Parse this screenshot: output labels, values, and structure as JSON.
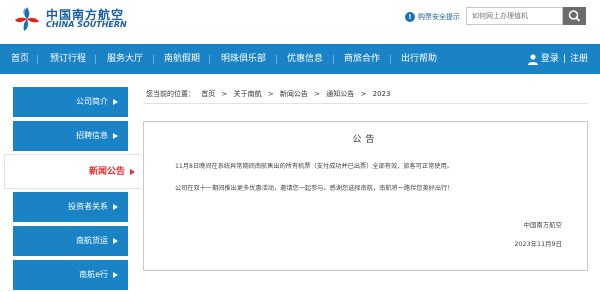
{
  "header": {
    "logo_cn": "中国南方航空",
    "logo_en": "CHINA SOUTHERN",
    "safety_tip": "购票安全提示",
    "search_placeholder": "如何网上办理值机"
  },
  "nav": {
    "items": [
      "首页",
      "预订行程",
      "服务大厅",
      "南航假期",
      "明珠俱乐部",
      "优惠信息",
      "商旅合作",
      "出行帮助"
    ],
    "login": "登录",
    "separator": "|",
    "register": "注册"
  },
  "sidebar": {
    "items": [
      "公司简介",
      "招聘信息",
      "新闻公告",
      "投资者关系",
      "南航货运",
      "南航e行"
    ],
    "active_index": 2
  },
  "breadcrumb": {
    "prefix": "您当前的位置：",
    "items": [
      "首页",
      "关于南航",
      "新闻公告",
      "通知公告",
      "2023"
    ],
    "separator": ">"
  },
  "notice": {
    "title": "公告",
    "p1": "11月8日晚间在系统异常期间南航售出的所有机票（支付成功并已出票）全部有效，旅客可正常使用。",
    "p2": "公司在双十一期间推出更多优惠活动，邀请您一起参与。感谢您选择南航，南航将一路伴您美好出行！",
    "signature": "中国南方航空",
    "date": "2023年11月9日"
  },
  "colors": {
    "brand_blue": "#1a83c6",
    "logo_blue": "#1a5fa0",
    "active_red": "#e02d2d"
  }
}
